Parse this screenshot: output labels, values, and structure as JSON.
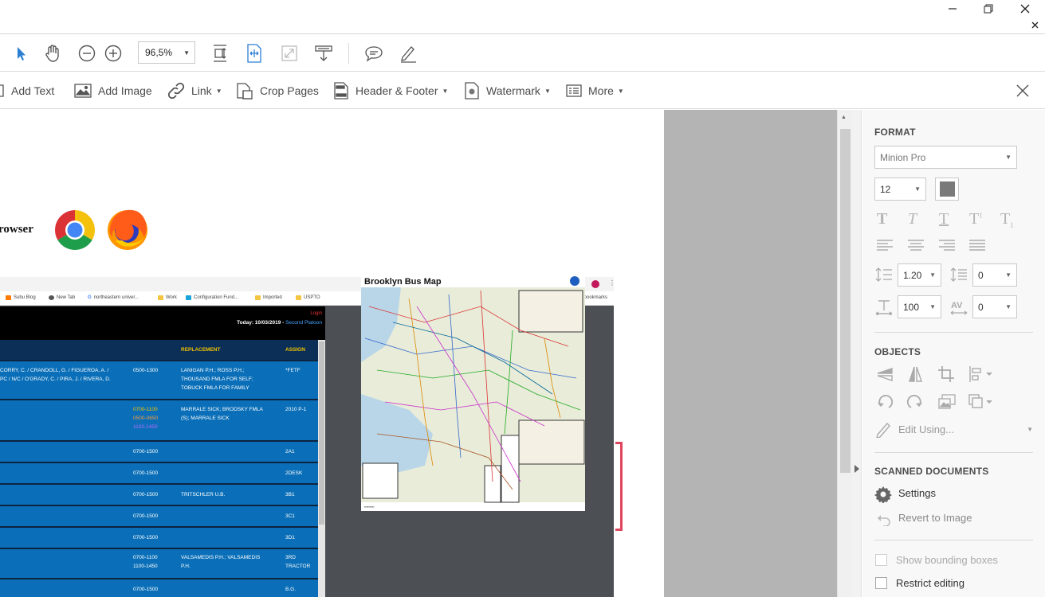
{
  "window": {
    "minimize_icon": "minimize-icon",
    "restore_icon": "restore-icon",
    "close_icon": "close-icon",
    "close_doc_icon": "close-icon"
  },
  "toolbar": {
    "zoom_value": "96,5%"
  },
  "edit_toolbar": {
    "add_text": "Add Text",
    "add_image": "Add Image",
    "link": "Link",
    "crop_pages": "Crop Pages",
    "header_footer": "Header & Footer",
    "watermark": "Watermark",
    "more": "More"
  },
  "document": {
    "browser_text": "rowser",
    "embedded": {
      "bookmarks": [
        "Subu Blog",
        "New Tab",
        "northeastern univer...",
        "Work",
        "Configuration Fund...",
        "Imported",
        "USPTO",
        "Other bookmarks"
      ],
      "login": "Login",
      "date_line": "Today: 10/03/2019 - ",
      "platoon": "Second Platoon",
      "headers": {
        "replacement": "REPLACEMENT",
        "assign": "ASSIGN"
      },
      "rows": [
        {
          "names": "CORRY, C. / CRANDOLL, G. / FIGUEROA, A. /\nPC / N/C / O'GRADY, C. / PIRA, J. / RIVERA, D.",
          "time": "0500-1300",
          "replacement": "LANIGAN P.H.; ROSS P.H.;\nTHOUSAND FMLA FOR SELF;\nTOBUCK FMLA FOR FAMILY",
          "assign": "*FETF"
        },
        {
          "names": "",
          "time": "0700-1100",
          "time2": "0500-0650",
          "time3": "1100-1450",
          "replacement": "MARRALE SICK; BRODSKY FMLA\n(S); MARRALE SICK",
          "assign": "2010 P-1"
        },
        {
          "names": "",
          "time": "0700-1500",
          "replacement": "",
          "assign": "2A1"
        },
        {
          "names": "",
          "time": "0700-1500",
          "replacement": "",
          "assign": "2DESK"
        },
        {
          "names": "",
          "time": "0700-1500",
          "replacement": "TRITSCHLER U.B.",
          "assign": "3B1"
        },
        {
          "names": "",
          "time": "0700-1500",
          "replacement": "",
          "assign": "3C1"
        },
        {
          "names": "",
          "time": "0700-1500",
          "replacement": "",
          "assign": "3D1"
        },
        {
          "names": "",
          "time": "0700-1100\n1100-1450",
          "replacement": "VALSAMEDIS P.H.; VALSAMEDIS\nP.H.",
          "assign": "3RD\nTRACTOR"
        },
        {
          "names": "",
          "time": "0700-1500",
          "replacement": "",
          "assign": "B.G."
        }
      ],
      "map_title": "Brooklyn Bus Map"
    }
  },
  "panel": {
    "format_title": "FORMAT",
    "font_name": "Minion Pro",
    "font_size": "12",
    "line_spacing": "1.20",
    "para_spacing": "0",
    "scale": "100",
    "char_spacing": "0",
    "objects_title": "OBJECTS",
    "edit_using": "Edit Using...",
    "scanned_title": "SCANNED DOCUMENTS",
    "settings": "Settings",
    "revert": "Revert to Image",
    "show_bounding": "Show bounding boxes",
    "restrict_editing": "Restrict editing"
  },
  "colors": {
    "accent_blue": "#2d7fd3",
    "table_blue": "#0a6fb8",
    "table_header": "#0b2f57",
    "header_gold": "#f2c200",
    "highlight_red": "#e0455e"
  }
}
